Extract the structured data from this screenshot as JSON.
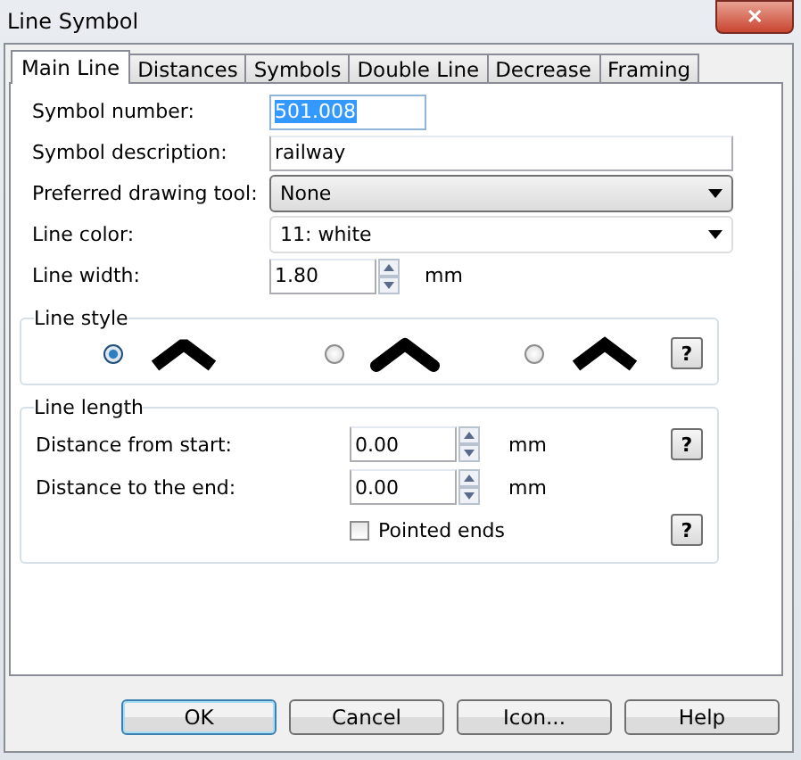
{
  "window": {
    "title": "Line Symbol",
    "close": "✕"
  },
  "tabs": [
    {
      "label": "Main Line",
      "selected": true
    },
    {
      "label": "Distances",
      "selected": false
    },
    {
      "label": "Symbols",
      "selected": false
    },
    {
      "label": "Double Line",
      "selected": false
    },
    {
      "label": "Decrease",
      "selected": false
    },
    {
      "label": "Framing",
      "selected": false
    }
  ],
  "symbol_number": {
    "label": "Symbol number:",
    "value": "501.008"
  },
  "symbol_description": {
    "label": "Symbol description:",
    "value": "railway"
  },
  "preferred_drawing_tool": {
    "label": "Preferred drawing tool:",
    "value": "None"
  },
  "line_color": {
    "label": "Line color:",
    "value": "11: white"
  },
  "line_width": {
    "label": "Line width:",
    "value": "1.80",
    "unit": "mm"
  },
  "line_style": {
    "title": "Line style",
    "help": "?",
    "options": [
      {
        "kind": "bevel",
        "selected": true
      },
      {
        "kind": "round",
        "selected": false
      },
      {
        "kind": "miter",
        "selected": false
      }
    ]
  },
  "line_length": {
    "title": "Line length",
    "help": "?",
    "fields": [
      {
        "label": "Distance from start:",
        "value": "0.00",
        "unit": "mm"
      },
      {
        "label": "Distance to the end:",
        "value": "0.00",
        "unit": "mm"
      }
    ],
    "pointed_ends": {
      "label": "Pointed ends",
      "checked": false,
      "help": "?"
    }
  },
  "buttons": [
    {
      "label": "OK",
      "default": true
    },
    {
      "label": "Cancel",
      "default": false
    },
    {
      "label": "Icon...",
      "default": false
    },
    {
      "label": "Help",
      "default": false
    }
  ]
}
